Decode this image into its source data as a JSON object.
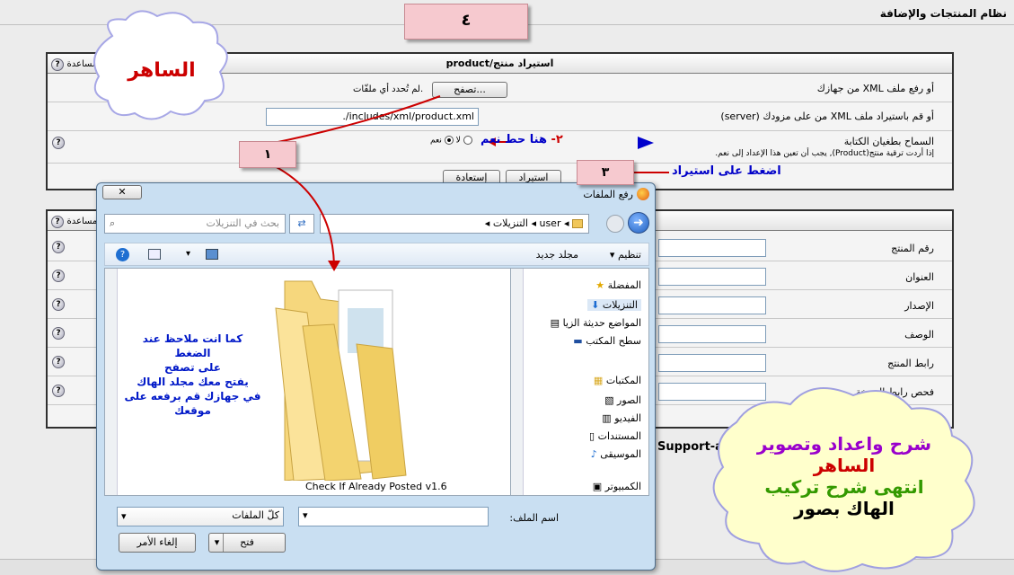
{
  "page": {
    "title": "نظام المنتجات والإضافة"
  },
  "step_note_4": "٤",
  "import_panel": {
    "title": "استيراد منتج/product",
    "help_label": "مساعدة",
    "upload_label": "أو رفع ملف XML من جهازك",
    "browse_button": "تصفح...",
    "no_file_text": ".لم تُحدد أي ملفّات",
    "server_label": "أو قم باستيراد ملف XML من على مزودك (server)",
    "server_path": "includes/xml/product.xml/.",
    "overwrite_label": "السماح بطغيان الكتابة",
    "overwrite_hint": "إذا أردت ترقية منتج(Product), يجب أن تعين هذا الإعداد إلى نعم.",
    "yes_label": "نعم",
    "no_label": "لا",
    "import_button": "استيراد",
    "restore_button": "إستعادة"
  },
  "details_panel": {
    "help_label": "مساعدة",
    "fields": [
      {
        "label": "رقم المنتج"
      },
      {
        "label": "العنوان"
      },
      {
        "label": "الإصدار"
      },
      {
        "label": "الوصف"
      },
      {
        "label": "رابط المنتج"
      },
      {
        "label": "فحص رابط النسخة"
      }
    ]
  },
  "footer_text": "Support-ar.c",
  "annotations": {
    "cloud_top": "الساهر",
    "step1": "١",
    "step2_prefix": "٢-",
    "step2_text": "هنا حط نعم",
    "step3": "٣",
    "step3_text": "اضغط على استيراد",
    "folder_caption_lines": [
      "كما انت ملاحظ عند الضغط",
      "على تصفح",
      "يفتح معك مجلد الهاك",
      "في جهازك قم برفعه على",
      "موقعك"
    ],
    "cloud_bottom": {
      "line1": "شرح واعداد وتصوير",
      "line2": "الساهر",
      "line3": "انتهى شرح تركيب",
      "line4": "الهاك  بصور"
    }
  },
  "dialog": {
    "title": "رفع الملفات",
    "close_glyph": "✕",
    "breadcrumb": [
      "user",
      "التنزيلات"
    ],
    "search_placeholder": "بحث في التنزيلات",
    "toolbar": {
      "organize": "تنظيم",
      "new_folder": "مجلد جديد"
    },
    "nav": {
      "favorites": "المفضلة",
      "favorites_items": [
        "التنزيلات",
        "المواضع حديثة الزيا",
        "سطح المكتب"
      ],
      "libraries": "المكتبات",
      "libraries_items": [
        "الصور",
        "الفيديو",
        "المستندات",
        "الموسيقى"
      ],
      "computer": "الكمبيوتر"
    },
    "file_item": "Check If Already Posted v1.6",
    "filename_label": "اسم الملف:",
    "filetype_value": "كلّ الملفات",
    "open_button": "فتح",
    "cancel_button": "إلغاء الأمر"
  },
  "colors": {
    "step2_arrow": "#cc0000",
    "cloud_fill": "#ffffcc",
    "cloud_stroke": "#a0a0e0",
    "purple": "#9900cc",
    "red": "#cc0000",
    "green": "#339900"
  }
}
